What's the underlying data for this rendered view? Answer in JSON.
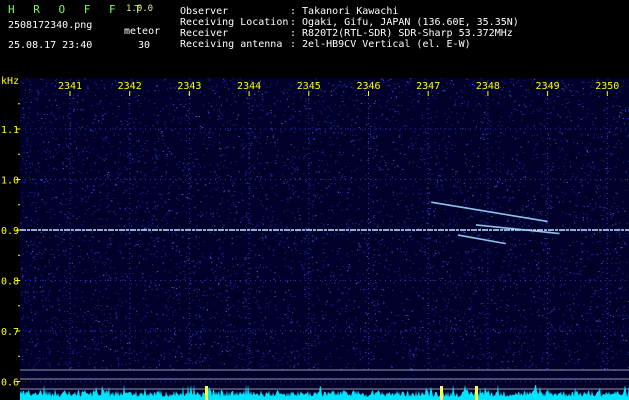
{
  "header": {
    "app_logo": "H R O F F T",
    "version": "1.0.0",
    "filename": "2508172340.png",
    "datetime": "25.08.17 23:40",
    "meteor_label": "meteor",
    "meteor_count": "30",
    "info_labels": [
      "Observer",
      "Receiving Location",
      "Receiver",
      "Receiving antenna"
    ],
    "info_values": [
      ": Takanori Kawachi",
      ": Ogaki, Gifu, JAPAN (136.60E, 35.35N)",
      ": R820T2(RTL-SDR) SDR-Sharp 53.372MHz",
      ": 2el-HB9CV Vertical (el. E-W)"
    ]
  },
  "colors": {
    "logo": "#7CFC5A",
    "axis_text": "#ffff00",
    "grid_dot": "#3344ff",
    "carrier": "#bfe8ff",
    "meteor": "#9fd8ff",
    "noise_bottom": "#00e5ff",
    "bright_marker": "#ffff40"
  },
  "chart_data": {
    "type": "heatmap",
    "xlabel": "",
    "ylabel": "kHz",
    "x_ticks": [
      "2341",
      "2342",
      "2343",
      "2344",
      "2345",
      "2346",
      "2347",
      "2348",
      "2349",
      "2350"
    ],
    "y_ticks": [
      "1.1",
      "1.0",
      "0.9",
      "0.8",
      "0.7",
      "0.6"
    ],
    "ylim": [
      0.58,
      1.2
    ],
    "carrier_khz": 0.9,
    "meteor_echoes": [
      {
        "start": "2347.05",
        "end": "2349.0",
        "khz_start": 0.955,
        "khz_end": 0.917
      },
      {
        "start": "2347.8",
        "end": "2349.2",
        "khz_start": 0.91,
        "khz_end": 0.893
      },
      {
        "start": "2347.5",
        "end": "2348.3",
        "khz_start": 0.89,
        "khz_end": 0.873
      }
    ]
  }
}
